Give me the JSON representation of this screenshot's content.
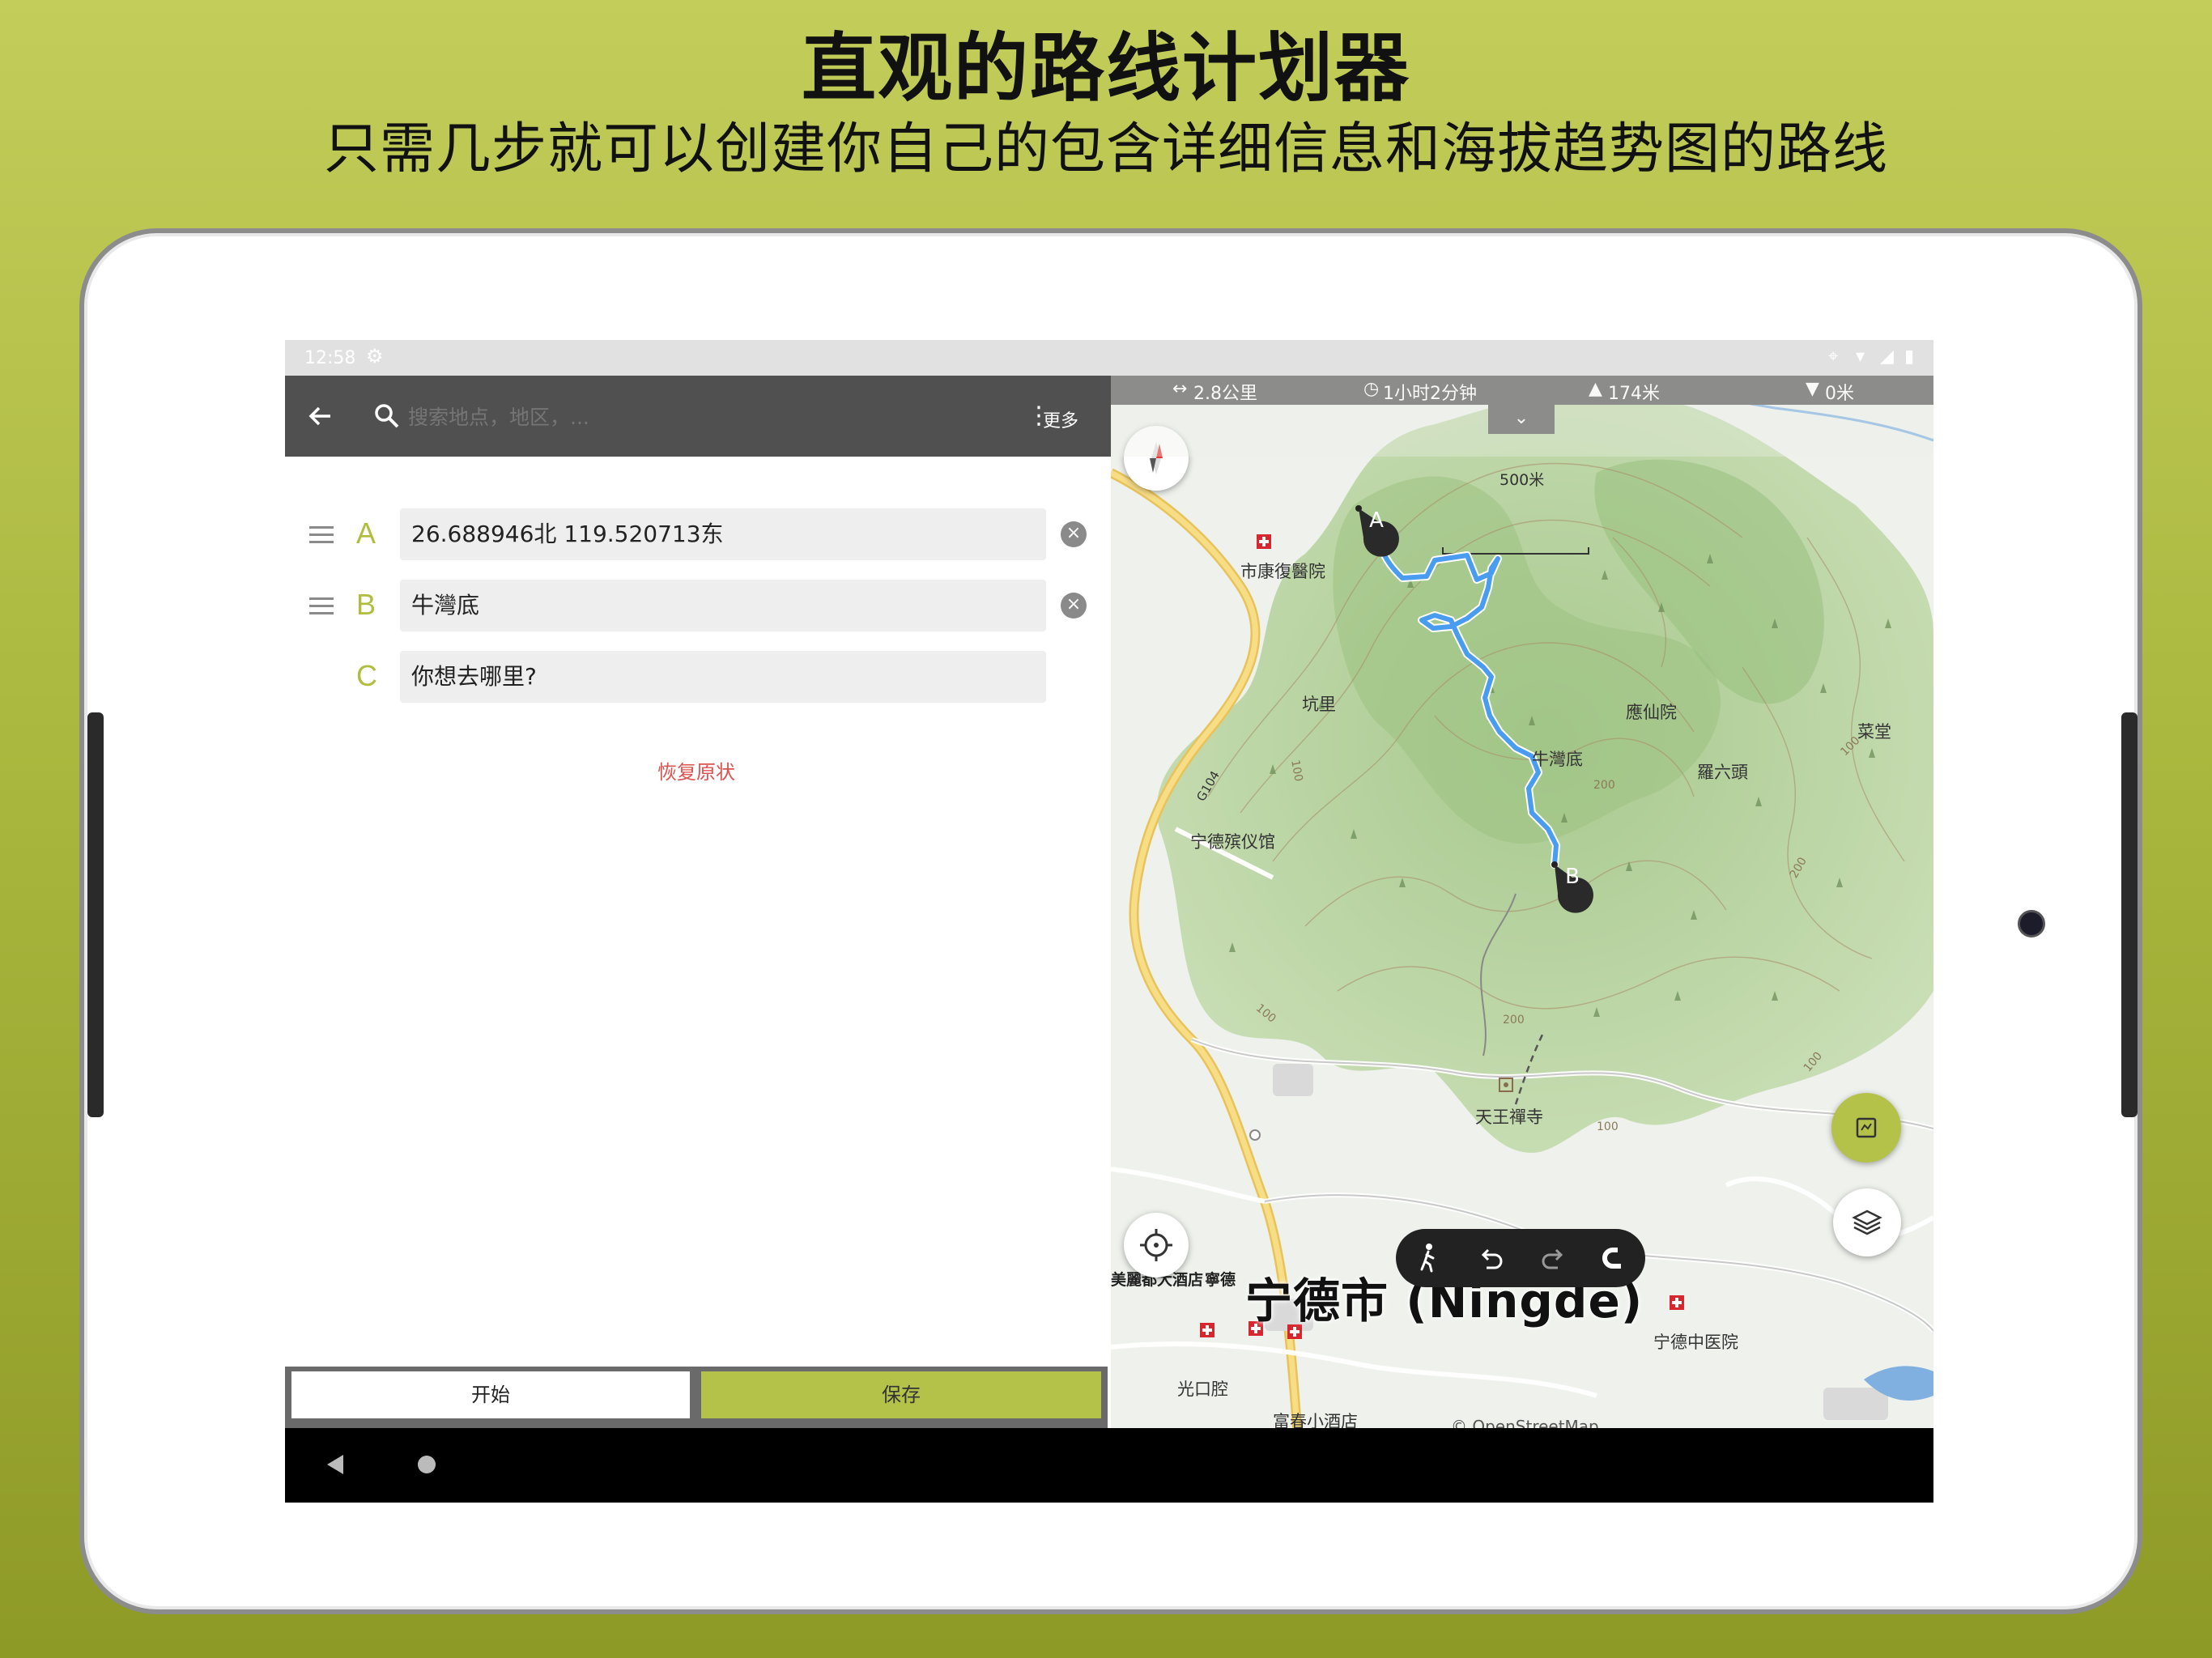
{
  "promo": {
    "headline": "直观的路线计划器",
    "subhead": "只需几步就可以创建你自己的包含详细信息和海拔趋势图的路线"
  },
  "status_bar": {
    "time": "12:58"
  },
  "toolbar": {
    "search_placeholder": "搜索地点，地区，...",
    "more_label": "更多"
  },
  "waypoints": [
    {
      "letter": "A",
      "value": "26.688946北 119.520713东",
      "clearable": true
    },
    {
      "letter": "B",
      "value": "牛灣底",
      "clearable": true
    },
    {
      "letter": "C",
      "value": "你想去哪里?",
      "clearable": false
    }
  ],
  "restore_label": "恢复原状",
  "buttons": {
    "start": "开始",
    "save": "保存"
  },
  "route_stats": {
    "distance": "2.8公里",
    "duration": "1小时2分钟",
    "ascent": "174米",
    "descent": "0米"
  },
  "map": {
    "scale_label": "500米",
    "city_label": "宁德市 (Ningde)",
    "attribution": "© OpenStreetMap",
    "marker_a": "A",
    "marker_b": "B",
    "road_label": "G104",
    "labels": {
      "hospital": "市康復醫院",
      "kengli": "坑里",
      "yingxian": "應仙院",
      "caitang": "菜堂",
      "niuwan": "牛灣底",
      "luoliutou": "羅六頭",
      "funeral": "宁德殡仪馆",
      "tianwang": "天王禪寺",
      "hotel": "美麗都大酒店",
      "hotel2": "寧德",
      "tcm": "宁德中医院",
      "dental": "光口腔",
      "fuchun": "富春小酒店"
    },
    "contours": [
      "100",
      "100",
      "200",
      "200",
      "200",
      "100",
      "100",
      "100"
    ]
  },
  "colors": {
    "accent": "#b5c24a",
    "route": "#4a9cf0",
    "restore": "#d9534f",
    "background": "#a9b73d"
  }
}
